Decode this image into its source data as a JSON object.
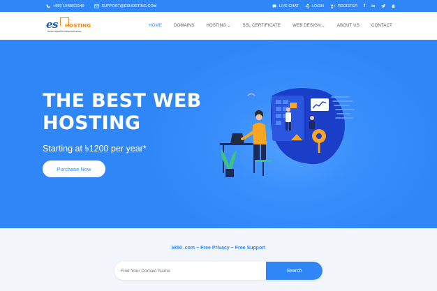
{
  "topbar": {
    "phone": "+880 1948893149",
    "email": "SUPPORT@ESHOSTING.COM",
    "live_chat": "LIVE CHAT",
    "login": "LOGIN",
    "register": "REGISTER",
    "social": [
      "facebook-icon",
      "linkedin-icon",
      "twitter-icon",
      "android-icon"
    ]
  },
  "logo": {
    "main": "es",
    "secondary": "HOSTING",
    "tagline": "Perfect Speed & Customized service"
  },
  "nav": {
    "items": [
      {
        "label": "HOME",
        "active": true,
        "dropdown": false
      },
      {
        "label": "DOMAINS",
        "active": false,
        "dropdown": false
      },
      {
        "label": "HOSTING",
        "active": false,
        "dropdown": true
      },
      {
        "label": "SSL CERTIFICATE",
        "active": false,
        "dropdown": false
      },
      {
        "label": "WEB DESIGN",
        "active": false,
        "dropdown": true
      },
      {
        "label": "ABOUT US",
        "active": false,
        "dropdown": false
      },
      {
        "label": "CONTACT",
        "active": false,
        "dropdown": false
      }
    ]
  },
  "hero": {
    "title": "THE BEST WEB HOSTING",
    "subtitle": "Starting at ৳1200 per year*",
    "cta": "Purchase Now"
  },
  "domain": {
    "promo": "৳850 .com ~ Free Privacy ~ Free Support",
    "placeholder": "Find Your Domain Name",
    "button": "Search"
  },
  "colors": {
    "primary": "#2f86f6",
    "accent": "#f08a1c"
  }
}
